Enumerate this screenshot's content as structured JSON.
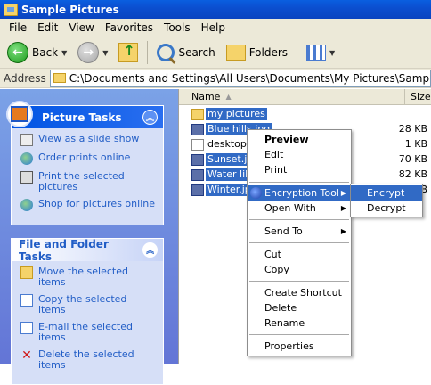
{
  "window": {
    "title": "Sample Pictures"
  },
  "menubar": {
    "items": [
      "File",
      "Edit",
      "View",
      "Favorites",
      "Tools",
      "Help"
    ]
  },
  "toolbar": {
    "back_label": "Back",
    "search_label": "Search",
    "folders_label": "Folders"
  },
  "address": {
    "label": "Address",
    "path": "C:\\Documents and Settings\\All Users\\Documents\\My Pictures\\Sample Pictures"
  },
  "picture_tasks": {
    "title": "Picture Tasks",
    "items": [
      "View as a slide show",
      "Order prints online",
      "Print the selected pictures",
      "Shop for pictures online"
    ]
  },
  "file_tasks": {
    "title": "File and Folder Tasks",
    "items": [
      "Move the selected items",
      "Copy the selected items",
      "E-mail the selected items",
      "Delete the selected items"
    ]
  },
  "filelist": {
    "col_name": "Name",
    "col_size": "Size",
    "rows": [
      {
        "name": "my pictures",
        "size": "",
        "type": "folder",
        "selected": true
      },
      {
        "name": "Blue hills.jpg",
        "size": "28 KB",
        "type": "jpg",
        "selected": true
      },
      {
        "name": "desktop.ini",
        "size": "1 KB",
        "type": "ini",
        "selected": false
      },
      {
        "name": "Sunset.jpg",
        "size": "70 KB",
        "type": "jpg",
        "selected": true
      },
      {
        "name": "Water lilies",
        "size": "82 KB",
        "type": "jpg",
        "selected": true
      },
      {
        "name": "Winter.jpg",
        "size": "1 KB",
        "type": "jpg",
        "selected": true
      }
    ]
  },
  "context_menu": {
    "preview": "Preview",
    "edit": "Edit",
    "print": "Print",
    "encryption_tool": "Encryption Tool",
    "open_with": "Open With",
    "send_to": "Send To",
    "cut": "Cut",
    "copy": "Copy",
    "create_shortcut": "Create Shortcut",
    "delete": "Delete",
    "rename": "Rename",
    "properties": "Properties"
  },
  "submenu": {
    "encrypt": "Encrypt",
    "decrypt": "Decrypt"
  },
  "colors": {
    "title_blue": "#0a4fd0",
    "selection": "#316ac5",
    "task_link": "#215dc6"
  }
}
